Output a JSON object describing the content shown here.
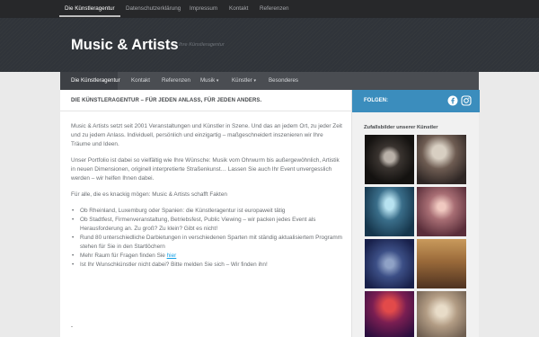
{
  "topbar": {
    "items": [
      "Die Künstleragentur",
      "Datenschutzerklärung",
      "Impressum",
      "Kontakt",
      "Referenzen"
    ]
  },
  "header": {
    "title": "Music & Artists",
    "tagline": "Ihre Künstleragentur"
  },
  "nav": {
    "items": [
      "Die Künstleragentur",
      "Kontakt",
      "Referenzen",
      "Musik",
      "Künstler",
      "Besonderes"
    ],
    "dropdown_marker": "▾"
  },
  "main": {
    "heading": "DIE KÜNSTLERAGENTUR – FÜR JEDEN ANLASS, FÜR JEDEN ANDERS.",
    "paragraphs": [
      "Music & Artists setzt seit 2001 Veranstaltungen und Künstler in Szene. Und das an jedem Ort, zu jeder Zeit und zu jedem Anlass. Individuell, persönlich und einzigartig –  maßgeschneidert inszenieren wir Ihre Träume und Ideen.",
      "Unser Portfolio ist dabei so vielfältig wie Ihre Wünsche: Musik vom Ohrwurm bis außergewöhnlich, Artistik in neuen Dimensionen, originell interpretierte Straßenkunst… Lassen Sie auch Ihr Event unvergesslich werden – wir helfen Ihnen dabei.",
      "Für alle, die es knackig mögen: Music & Artists schafft Fakten"
    ],
    "bullets": [
      "Ob Rheinland, Luxemburg oder Spanien: die Künstleragentur ist europaweit tätig",
      "Ob Stadtfest, Firmenveranstaltung, Betriebsfest, Public Viewing – wir packen jedes Event als Herausforderung an. Zu groß? Zu klein? Gibt es nicht!",
      "Rund 80 unterschiedliche Darbietungen in verschiedenen Sparten mit ständig aktualisiertem Programm stehen für Sie in den Startlöchern"
    ],
    "bullet_link_prefix": "Mehr Raum für Fragen finden Sie ",
    "bullet_link_text": "hier",
    "bullet_last": "Ist Ihr Wunschkünstler nicht dabei? Bitte melden Sie sich   – Wir finden ihn!"
  },
  "sidebar": {
    "follow_label": "FOLGEN:",
    "social_icons": [
      "facebook-icon",
      "instagram-icon"
    ],
    "gallery_title": "Zufallsbilder unserer Künstler",
    "gallery_count": 8
  },
  "colors": {
    "accent": "#3b8dbd",
    "link": "#16a1e7",
    "topbar": "#27282a",
    "nav": "#4a4d52"
  }
}
